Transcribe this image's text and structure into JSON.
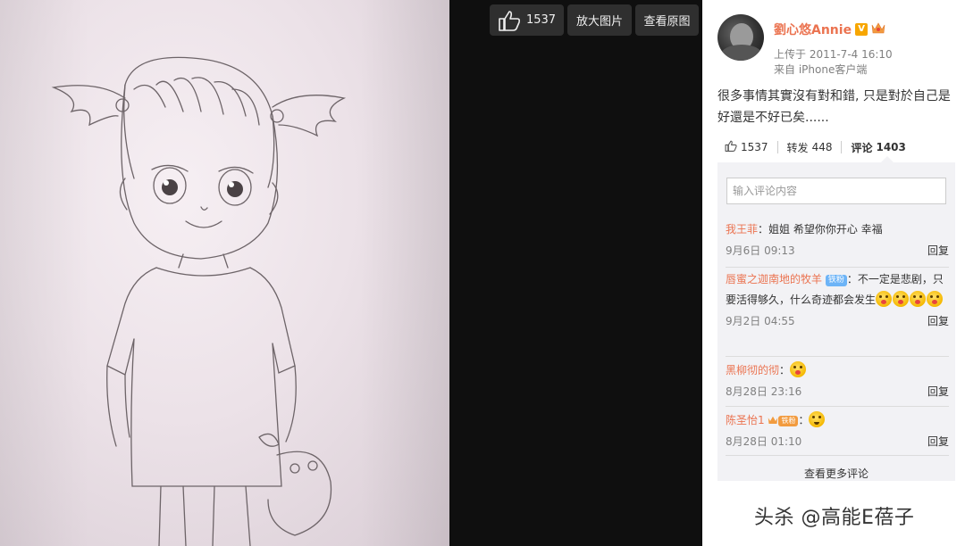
{
  "toolbar": {
    "like_count": "1537",
    "zoom_label": "放大图片",
    "view_original_label": "查看原图"
  },
  "post": {
    "username": "劉心悠Annie",
    "verified_badge": "V",
    "uploaded": "上传于 2011-7-4 16:10",
    "source": "来自 iPhone客户端",
    "text": "很多事情其實沒有對和錯, 只是對於自己是好還是不好已矣......"
  },
  "stats": {
    "likes": "1537",
    "repost_label": "转发",
    "repost_count": "448",
    "comment_label": "评论",
    "comment_count": "1403"
  },
  "comment_input": {
    "placeholder": "输入评论内容"
  },
  "comments": [
    {
      "author": "我王菲",
      "text": "：姐姐 希望你你开心 幸福",
      "time": "9月6日 09:13",
      "reply": "回复"
    },
    {
      "author": "唇蜜之迦南地的牧羊",
      "badge": "铁粉",
      "text": "：不一定是悲剧，只要活得够久，什么奇迹都会发生",
      "time": "9月2日 04:55",
      "reply": "回复"
    },
    {
      "author": "黑柳彻的彻",
      "text": "：",
      "time": "8月28日 23:16",
      "reply": "回复"
    },
    {
      "author": "陈圣怡1",
      "badge": "铁粉",
      "text": "：",
      "time": "8月28日 01:10",
      "reply": "回复"
    }
  ],
  "more_comments": "查看更多评论",
  "watermark": "头杀 @高能E蓓子",
  "colors": {
    "accent": "#eb7350",
    "panel_bg": "#f2f2f5",
    "dark_bg": "#0f0f0f"
  },
  "icons": [
    "thumbs-up-icon",
    "verified-icon",
    "crown-icon",
    "emoji-icon"
  ]
}
